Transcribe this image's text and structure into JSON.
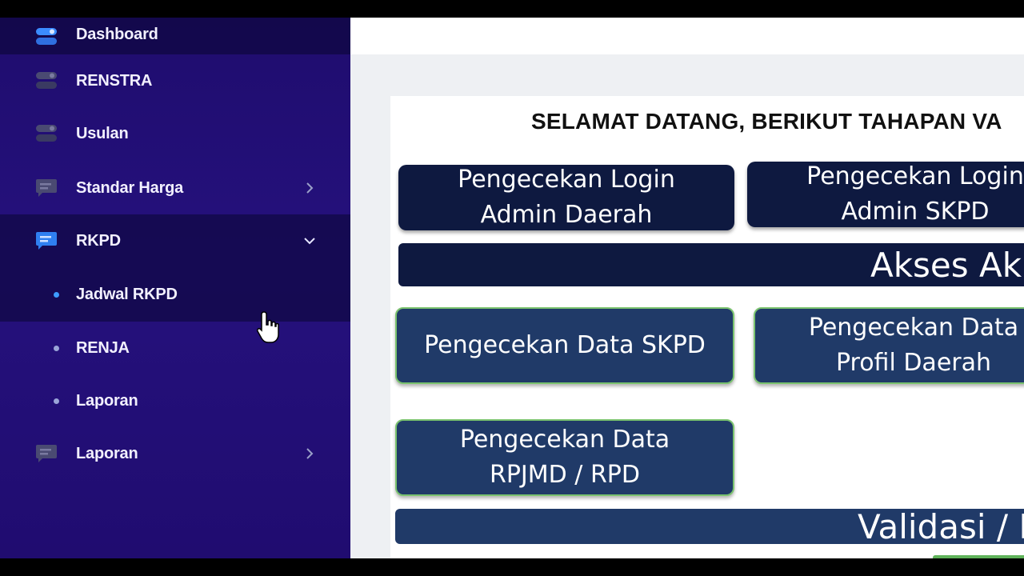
{
  "sidebar": {
    "items": [
      {
        "label": "Dashboard",
        "icon": "toggle-icon"
      },
      {
        "label": "RENSTRA",
        "icon": "toggle-icon"
      },
      {
        "label": "Usulan",
        "icon": "toggle-icon"
      },
      {
        "label": "Standar Harga",
        "icon": "message-icon",
        "chevron": "chevron-right-icon"
      },
      {
        "label": "RKPD",
        "icon": "message-icon",
        "chevron": "chevron-down-icon",
        "expanded": true
      },
      {
        "label": "Jadwal RKPD",
        "sub": true,
        "active": true
      },
      {
        "label": "RENJA",
        "sub": true
      },
      {
        "label": "Laporan",
        "sub": true
      },
      {
        "label": "Laporan",
        "icon": "message-icon",
        "chevron": "chevron-right-icon"
      }
    ]
  },
  "main": {
    "welcome": "SELAMAT DATANG, BERIKUT TAHAPAN VA",
    "login_admin_daerah": [
      "Pengecekan Login",
      "Admin Daerah"
    ],
    "login_admin_skpd": [
      "Pengecekan Login",
      "Admin SKPD"
    ],
    "akses_bar": "Akses Ak",
    "data_skpd": "Pengecekan Data SKPD",
    "data_profil": [
      "Pengecekan Data",
      "Profil Daerah"
    ],
    "data_rpjmd": [
      "Pengecekan Data",
      "RPJMD / RPD"
    ],
    "validasi_bar": "Validasi / P"
  },
  "colors": {
    "sidebar_bg": "#25117d",
    "box_dark": "#0e1940",
    "box_blue": "#203a68",
    "box_border": "#7bc36f",
    "active_dot": "#3d9cff"
  }
}
